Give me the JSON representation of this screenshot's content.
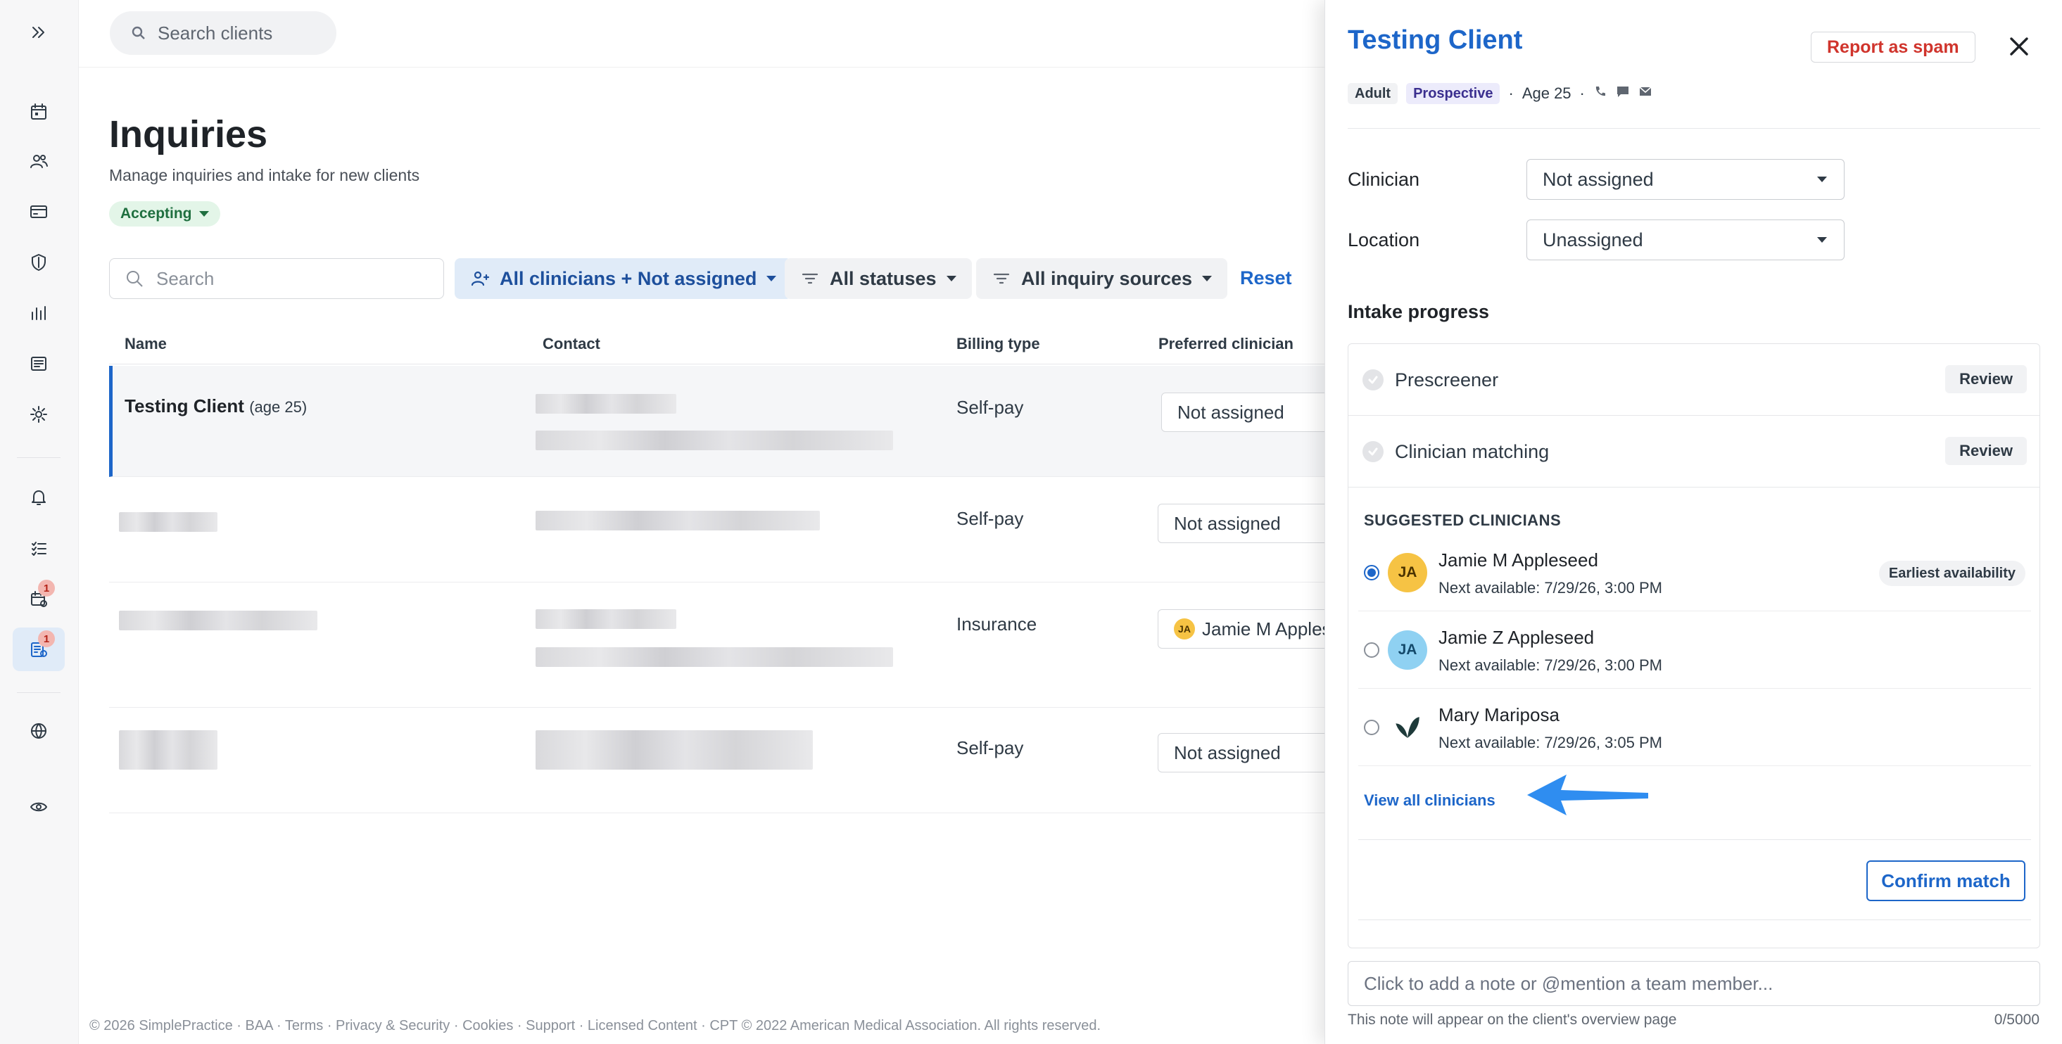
{
  "topbar": {
    "search_placeholder": "Search clients"
  },
  "nav": {
    "badges": {
      "calendar_plus": "1",
      "inquiries": "1"
    }
  },
  "page": {
    "title": "Inquiries",
    "subtitle": "Manage inquiries and intake for new clients",
    "status_pill": "Accepting"
  },
  "filters": {
    "search_placeholder": "Search",
    "clinicians": "All clinicians + Not assigned",
    "statuses": "All statuses",
    "sources": "All inquiry sources",
    "reset": "Reset"
  },
  "table": {
    "columns": [
      "Name",
      "Contact",
      "Billing type",
      "Preferred clinician"
    ],
    "rows": [
      {
        "name": "Testing Client",
        "age": "(age 25)",
        "billing": "Self-pay",
        "preferred": "Not assigned"
      },
      {
        "billing": "Self-pay",
        "preferred": "Not assigned"
      },
      {
        "billing": "Insurance",
        "preferred": "Jamie M Appleseed",
        "preferred_initials": "JA"
      },
      {
        "billing": "Self-pay",
        "preferred": "Not assigned"
      }
    ]
  },
  "footer": "© 2026 SimplePractice · BAA · Terms · Privacy & Security · Cookies · Support · Licensed Content · CPT © 2022 American Medical Association. All rights reserved.",
  "panel": {
    "title": "Testing Client",
    "spam_button": "Report as spam",
    "tags": [
      "Adult",
      "Prospective"
    ],
    "age": "Age 25",
    "fields": {
      "clinician_label": "Clinician",
      "clinician_value": "Not assigned",
      "location_label": "Location",
      "location_value": "Unassigned"
    },
    "intake_title": "Intake progress",
    "steps": [
      {
        "label": "Prescreener",
        "action": "Review"
      },
      {
        "label": "Clinician matching",
        "action": "Review"
      }
    ],
    "suggested_title": "SUGGESTED CLINICIANS",
    "clinicians": [
      {
        "initials": "JA",
        "name": "Jamie M Appleseed",
        "next": "Next available: 7/29/26, 3:00 PM",
        "badge": "Earliest availability",
        "selected": true,
        "avatar_color": "#f6c344"
      },
      {
        "initials": "JA",
        "name": "Jamie Z Appleseed",
        "next": "Next available: 7/29/26, 3:00 PM",
        "selected": false,
        "avatar_color": "#8fd1f2"
      },
      {
        "initials": "",
        "name": "Mary Mariposa",
        "next": "Next available: 7/29/26, 3:05 PM",
        "selected": false
      }
    ],
    "view_all": "View all clinicians",
    "confirm": "Confirm match",
    "note_placeholder": "Click to add a note or @mention a team member...",
    "note_help": "This note will appear on the client's overview page",
    "note_count": "0/5000"
  },
  "colors": {
    "accent": "#1d66c9",
    "danger": "#d0342c",
    "arrow": "#2f8df0"
  }
}
